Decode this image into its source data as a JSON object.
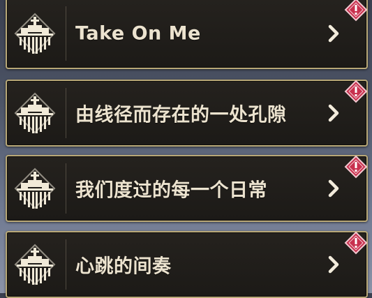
{
  "quests": [
    {
      "title": "Take On Me",
      "emblem_icon": "castle-emblem-icon",
      "alert": true,
      "alert_icon": "exclamation-diamond-icon"
    },
    {
      "title": "由线径而存在的一处孔隙",
      "emblem_icon": "castle-emblem-icon",
      "alert": true,
      "alert_icon": "exclamation-diamond-icon"
    },
    {
      "title": "我们度过的每一个日常",
      "emblem_icon": "castle-emblem-icon",
      "alert": true,
      "alert_icon": "exclamation-diamond-icon"
    },
    {
      "title": "心跳的间奏",
      "emblem_icon": "castle-emblem-icon",
      "alert": true,
      "alert_icon": "exclamation-diamond-icon"
    }
  ],
  "colors": {
    "card_border": "#b8a877",
    "card_bg": "#1f1d1a",
    "title_text": "#ece3cf",
    "emblem": "#f1ead8",
    "alert_badge": "#c8304e",
    "chevron": "#f3ecdc"
  }
}
